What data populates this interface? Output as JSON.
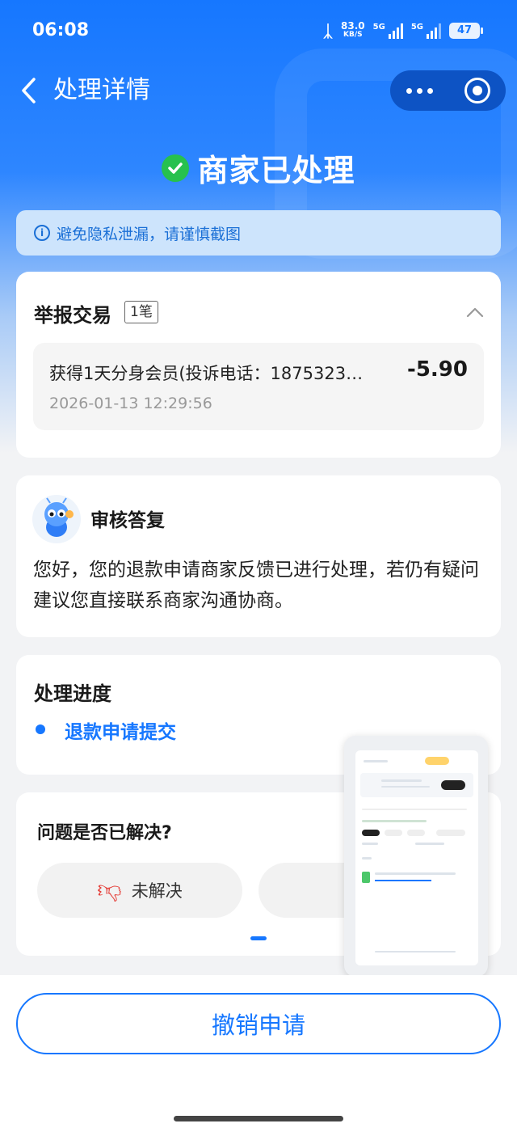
{
  "status_bar": {
    "time": "06:08",
    "speed_value": "83.0",
    "speed_unit": "KB/S",
    "network1": "5G",
    "network2": "5G",
    "battery": "47"
  },
  "nav": {
    "title": "处理详情"
  },
  "status": {
    "title": "商家已处理"
  },
  "privacy_notice": "避免隐私泄漏，请谨慎截图",
  "report": {
    "title": "举报交易",
    "count_badge": "1笔",
    "transaction": {
      "name": "获得1天分身会员(投诉电话：1875323…",
      "amount": "-5.90",
      "time": "2026-01-13 12:29:56"
    }
  },
  "review": {
    "title": "审核答复",
    "body": "您好，您的退款申请商家反馈已进行处理，若仍有疑问建议您直接联系商家沟通协商。"
  },
  "progress": {
    "title": "处理进度",
    "step": "退款申请提交"
  },
  "feedback": {
    "question": "问题是否已解决?",
    "unresolved_label": "未解决"
  },
  "bottom": {
    "cancel_label": "撤销申请"
  },
  "colors": {
    "brand": "#1677ff",
    "success": "#27c14e"
  }
}
